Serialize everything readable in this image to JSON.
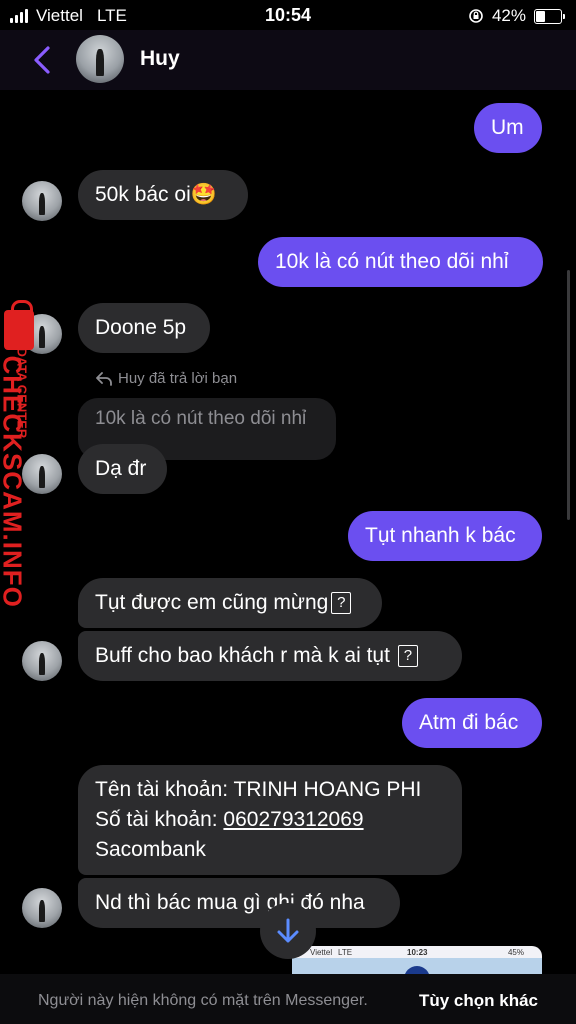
{
  "status": {
    "carrier": "Viettel",
    "network": "LTE",
    "time": "10:54",
    "battery_percent": "42%",
    "battery_level": 0.42
  },
  "header": {
    "contact_name": "Huy"
  },
  "messages": {
    "m1": "Um",
    "m2": "50k bác oi🤩",
    "m3": "10k là có nút theo dõi nhỉ",
    "m4": "Doone 5p",
    "reply_label": "Huy đã trả lời bạn",
    "reply_quote": "10k là có nút theo dõi nhỉ",
    "m5": "Dạ đr",
    "m6": "Tụt nhanh k bác",
    "m7": "Tụt được em cũng mừng",
    "m8": "Buff cho bao khách r mà k ai tụt",
    "m9": "Atm đi bác",
    "m10_line1": "Tên tài khoản: TRINH HOANG PHI",
    "m10_line2_prefix": "Số tài khoản: ",
    "m10_account": "060279312069",
    "m10_line3": "Sacombank",
    "m11": "Nd thì bác mua gì ghi đó nha",
    "unknown_glyph": "?"
  },
  "watermark": {
    "main": "CHECKSCAM.INFO",
    "sub": "DATA CENTER"
  },
  "thumbnail": {
    "carrier": "Viettel",
    "network": "LTE",
    "time": "10:23",
    "battery": "45%"
  },
  "footer": {
    "note": "Người này hiện không có mặt trên Messenger.",
    "action": "Tùy chọn khác"
  },
  "colors": {
    "outgoing_bubble": "#6b4ff0",
    "incoming_bubble": "#2c2c2e",
    "accent": "#7c4dff",
    "watermark": "#e02020"
  }
}
